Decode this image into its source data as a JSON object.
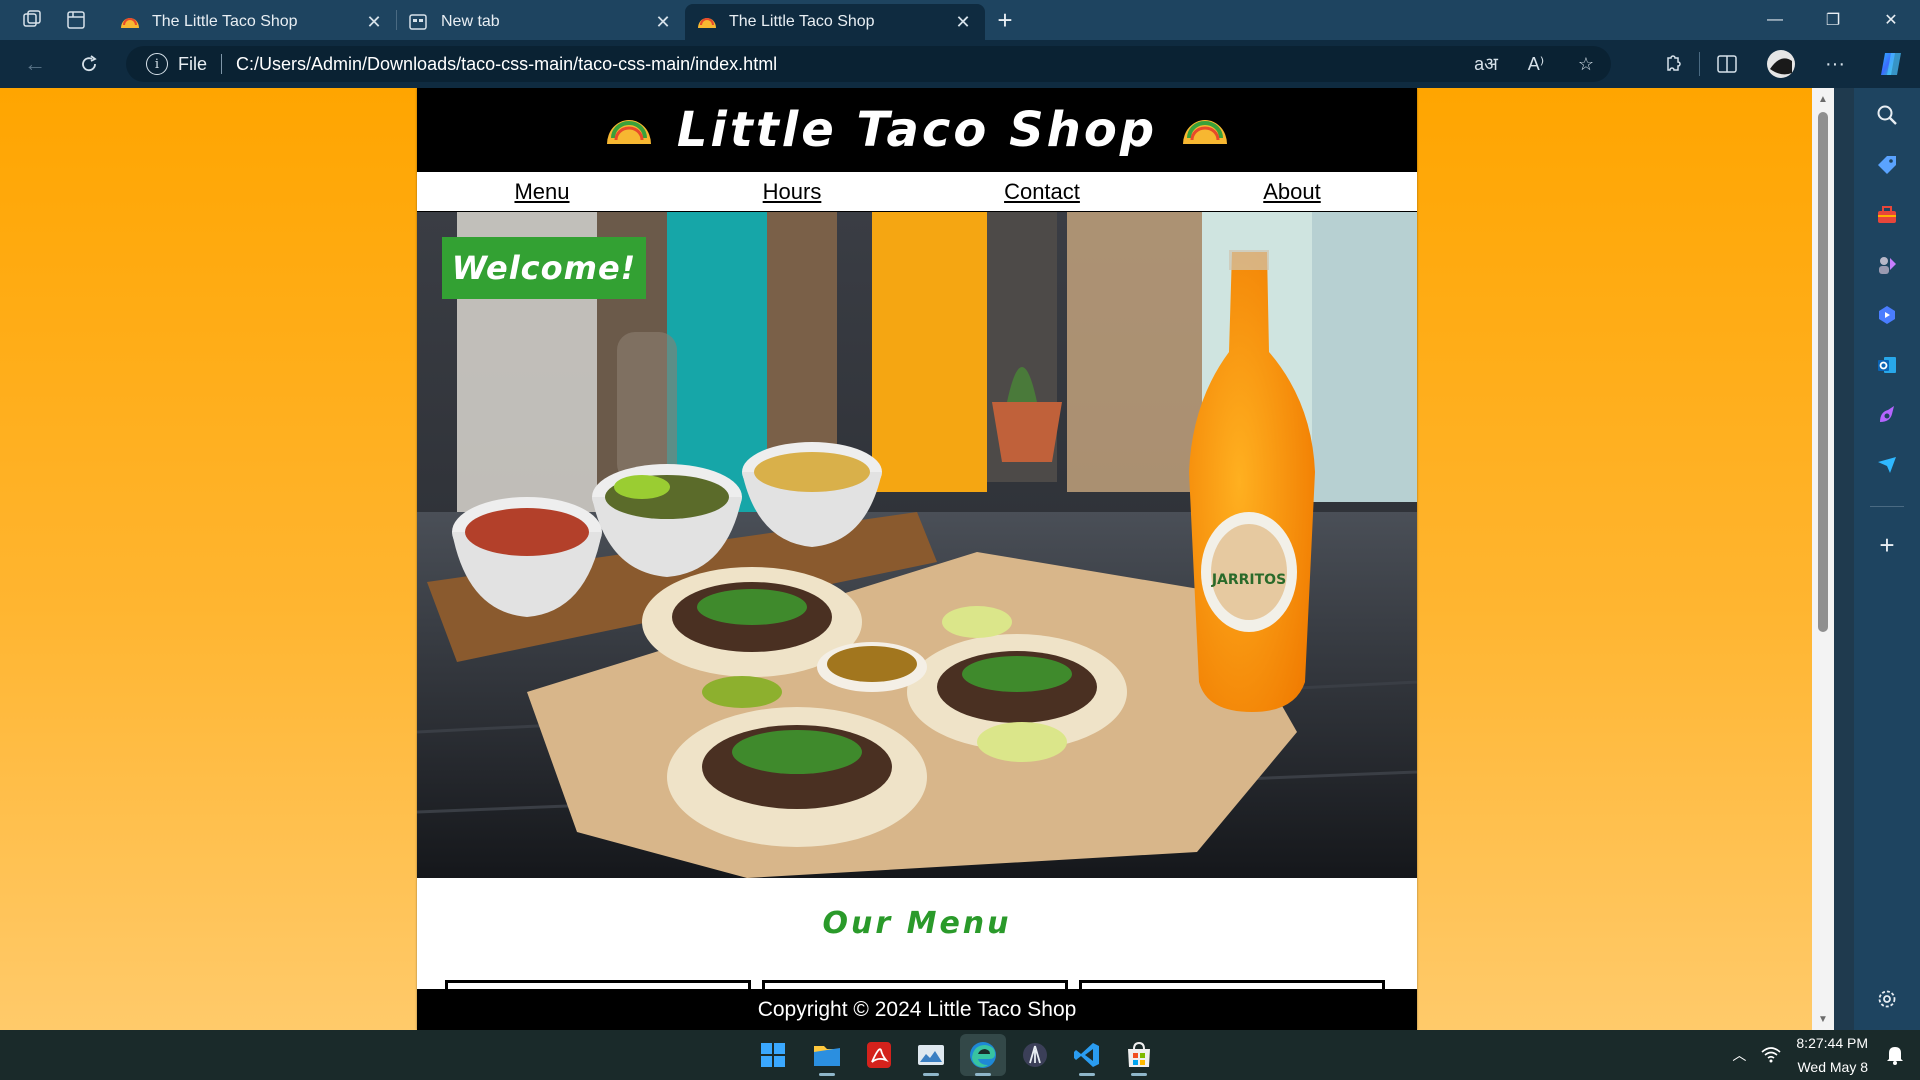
{
  "browser": {
    "tabs": [
      {
        "title": "The Little Taco Shop",
        "favicon": "taco-icon",
        "active": false
      },
      {
        "title": "New tab",
        "favicon": "newtab-icon",
        "active": false
      },
      {
        "title": "The Little Taco Shop",
        "favicon": "taco-icon",
        "active": true
      }
    ],
    "address": {
      "scheme_label": "File",
      "url": "C:/Users/Admin/Downloads/taco-css-main/taco-css-main/index.html"
    }
  },
  "page": {
    "site_title": "Little Taco Shop",
    "nav": [
      "Menu",
      "Hours",
      "Contact",
      "About"
    ],
    "welcome": "Welcome!",
    "menu_heading": "Our Menu",
    "footer": "Copyright © 2024 Little Taco Shop",
    "colors": {
      "background_top": "#ffa500",
      "header": "#000000",
      "welcome_badge": "#33a133",
      "heading_green": "#2a9a2a"
    }
  },
  "sidebar": {
    "icons": [
      "search-icon",
      "tag-icon",
      "toolbox-icon",
      "games-icon",
      "copilot-play-icon",
      "outlook-icon",
      "designer-icon",
      "send-icon",
      "add-icon",
      "settings-icon"
    ]
  },
  "taskbar": {
    "apps": [
      "windows-start-icon",
      "file-explorer-icon",
      "acrobat-icon",
      "photos-icon",
      "edge-icon",
      "vpn-icon",
      "vscode-icon",
      "store-icon"
    ],
    "time": "8:27:44 PM",
    "date": "Wed May 8"
  }
}
